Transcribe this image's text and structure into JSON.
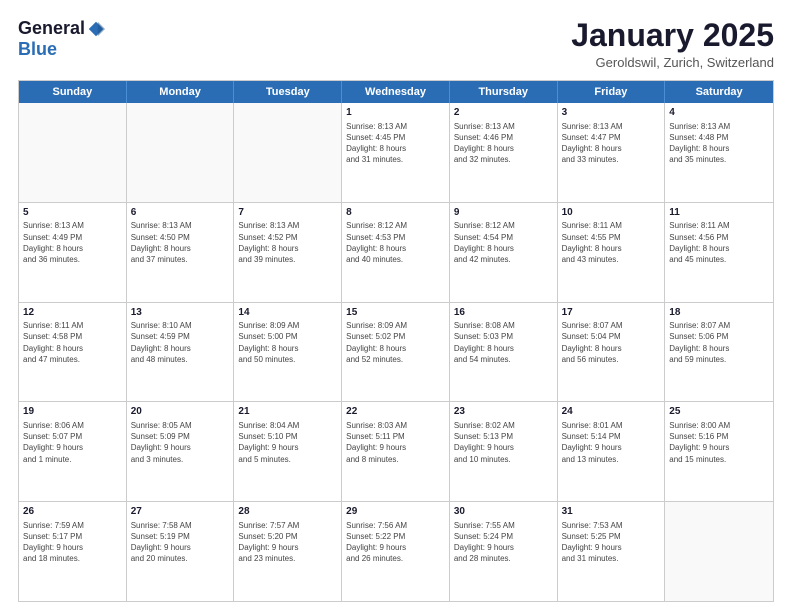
{
  "logo": {
    "general": "General",
    "blue": "Blue"
  },
  "header": {
    "month_title": "January 2025",
    "location": "Geroldswil, Zurich, Switzerland"
  },
  "weekdays": [
    "Sunday",
    "Monday",
    "Tuesday",
    "Wednesday",
    "Thursday",
    "Friday",
    "Saturday"
  ],
  "rows": [
    [
      {
        "day": "",
        "info": ""
      },
      {
        "day": "",
        "info": ""
      },
      {
        "day": "",
        "info": ""
      },
      {
        "day": "1",
        "info": "Sunrise: 8:13 AM\nSunset: 4:45 PM\nDaylight: 8 hours\nand 31 minutes."
      },
      {
        "day": "2",
        "info": "Sunrise: 8:13 AM\nSunset: 4:46 PM\nDaylight: 8 hours\nand 32 minutes."
      },
      {
        "day": "3",
        "info": "Sunrise: 8:13 AM\nSunset: 4:47 PM\nDaylight: 8 hours\nand 33 minutes."
      },
      {
        "day": "4",
        "info": "Sunrise: 8:13 AM\nSunset: 4:48 PM\nDaylight: 8 hours\nand 35 minutes."
      }
    ],
    [
      {
        "day": "5",
        "info": "Sunrise: 8:13 AM\nSunset: 4:49 PM\nDaylight: 8 hours\nand 36 minutes."
      },
      {
        "day": "6",
        "info": "Sunrise: 8:13 AM\nSunset: 4:50 PM\nDaylight: 8 hours\nand 37 minutes."
      },
      {
        "day": "7",
        "info": "Sunrise: 8:13 AM\nSunset: 4:52 PM\nDaylight: 8 hours\nand 39 minutes."
      },
      {
        "day": "8",
        "info": "Sunrise: 8:12 AM\nSunset: 4:53 PM\nDaylight: 8 hours\nand 40 minutes."
      },
      {
        "day": "9",
        "info": "Sunrise: 8:12 AM\nSunset: 4:54 PM\nDaylight: 8 hours\nand 42 minutes."
      },
      {
        "day": "10",
        "info": "Sunrise: 8:11 AM\nSunset: 4:55 PM\nDaylight: 8 hours\nand 43 minutes."
      },
      {
        "day": "11",
        "info": "Sunrise: 8:11 AM\nSunset: 4:56 PM\nDaylight: 8 hours\nand 45 minutes."
      }
    ],
    [
      {
        "day": "12",
        "info": "Sunrise: 8:11 AM\nSunset: 4:58 PM\nDaylight: 8 hours\nand 47 minutes."
      },
      {
        "day": "13",
        "info": "Sunrise: 8:10 AM\nSunset: 4:59 PM\nDaylight: 8 hours\nand 48 minutes."
      },
      {
        "day": "14",
        "info": "Sunrise: 8:09 AM\nSunset: 5:00 PM\nDaylight: 8 hours\nand 50 minutes."
      },
      {
        "day": "15",
        "info": "Sunrise: 8:09 AM\nSunset: 5:02 PM\nDaylight: 8 hours\nand 52 minutes."
      },
      {
        "day": "16",
        "info": "Sunrise: 8:08 AM\nSunset: 5:03 PM\nDaylight: 8 hours\nand 54 minutes."
      },
      {
        "day": "17",
        "info": "Sunrise: 8:07 AM\nSunset: 5:04 PM\nDaylight: 8 hours\nand 56 minutes."
      },
      {
        "day": "18",
        "info": "Sunrise: 8:07 AM\nSunset: 5:06 PM\nDaylight: 8 hours\nand 59 minutes."
      }
    ],
    [
      {
        "day": "19",
        "info": "Sunrise: 8:06 AM\nSunset: 5:07 PM\nDaylight: 9 hours\nand 1 minute."
      },
      {
        "day": "20",
        "info": "Sunrise: 8:05 AM\nSunset: 5:09 PM\nDaylight: 9 hours\nand 3 minutes."
      },
      {
        "day": "21",
        "info": "Sunrise: 8:04 AM\nSunset: 5:10 PM\nDaylight: 9 hours\nand 5 minutes."
      },
      {
        "day": "22",
        "info": "Sunrise: 8:03 AM\nSunset: 5:11 PM\nDaylight: 9 hours\nand 8 minutes."
      },
      {
        "day": "23",
        "info": "Sunrise: 8:02 AM\nSunset: 5:13 PM\nDaylight: 9 hours\nand 10 minutes."
      },
      {
        "day": "24",
        "info": "Sunrise: 8:01 AM\nSunset: 5:14 PM\nDaylight: 9 hours\nand 13 minutes."
      },
      {
        "day": "25",
        "info": "Sunrise: 8:00 AM\nSunset: 5:16 PM\nDaylight: 9 hours\nand 15 minutes."
      }
    ],
    [
      {
        "day": "26",
        "info": "Sunrise: 7:59 AM\nSunset: 5:17 PM\nDaylight: 9 hours\nand 18 minutes."
      },
      {
        "day": "27",
        "info": "Sunrise: 7:58 AM\nSunset: 5:19 PM\nDaylight: 9 hours\nand 20 minutes."
      },
      {
        "day": "28",
        "info": "Sunrise: 7:57 AM\nSunset: 5:20 PM\nDaylight: 9 hours\nand 23 minutes."
      },
      {
        "day": "29",
        "info": "Sunrise: 7:56 AM\nSunset: 5:22 PM\nDaylight: 9 hours\nand 26 minutes."
      },
      {
        "day": "30",
        "info": "Sunrise: 7:55 AM\nSunset: 5:24 PM\nDaylight: 9 hours\nand 28 minutes."
      },
      {
        "day": "31",
        "info": "Sunrise: 7:53 AM\nSunset: 5:25 PM\nDaylight: 9 hours\nand 31 minutes."
      },
      {
        "day": "",
        "info": ""
      }
    ]
  ]
}
